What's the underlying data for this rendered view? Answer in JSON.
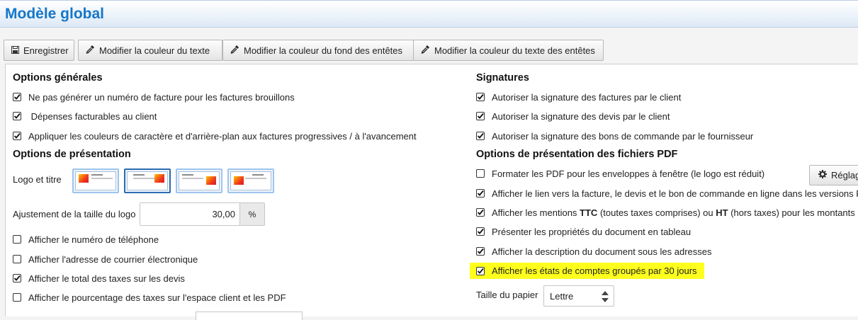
{
  "page": {
    "title": "Modèle global"
  },
  "toolbar": {
    "save_label": "Enregistrer",
    "text_color_label": "Modifier la couleur du texte",
    "header_bg_label": "Modifier la couleur du fond des entêtes",
    "header_text_label": "Modifier la couleur du texte des entêtes"
  },
  "general": {
    "title": "Options générales",
    "options": [
      {
        "label": "Ne pas générer un numéro de facture pour les factures brouillons",
        "checked": true
      },
      {
        "label": " Dépenses facturables au client",
        "checked": true
      },
      {
        "label": "Appliquer les couleurs de caractère et d'arrière-plan aux factures progressives / à l'avancement",
        "checked": true
      }
    ]
  },
  "presentation": {
    "title": "Options de présentation",
    "logo_label": "Logo et titre",
    "logo_size_label": "Ajustement de la taille du logo",
    "logo_size_value": "30,00",
    "logo_size_unit": "%",
    "options": [
      {
        "label": "Afficher le numéro de téléphone",
        "checked": false
      },
      {
        "label": "Afficher l'adresse de courrier électronique",
        "checked": false
      },
      {
        "label": "Afficher le total des taxes sur les devis",
        "checked": true
      },
      {
        "label": "Afficher le pourcentage des taxes sur l'espace client et les PDF",
        "checked": false
      }
    ]
  },
  "signatures": {
    "title": "Signatures",
    "options": [
      {
        "label": "Autoriser la signature des factures par le client",
        "checked": true
      },
      {
        "label": "Autoriser la signature des devis par le client",
        "checked": true
      },
      {
        "label": "Autoriser la signature des bons de commande par le fournisseur",
        "checked": true
      }
    ]
  },
  "pdf": {
    "title": "Options de présentation des fichiers PDF",
    "settings_button": "Réglag",
    "options": [
      {
        "label": "Formater les PDF pour les enveloppes à fenêtre (le logo est réduit)",
        "checked": false
      },
      {
        "label": "Afficher le lien vers la facture, le devis et le bon de commande en ligne dans les versions PDF",
        "checked": true
      },
      {
        "label_before": "Afficher les mentions ",
        "ttc": "TTC",
        "label_middle": " (toutes taxes comprises) ou ",
        "ht": "HT",
        "label_after": " (hors taxes) pour les montants",
        "checked": true
      },
      {
        "label": "Présenter les propriétés du document en tableau",
        "checked": true
      },
      {
        "label": "Afficher la description du document sous les adresses",
        "checked": true
      },
      {
        "label": "Afficher les états de comptes groupés par 30 jours",
        "checked": true,
        "highlighted": true
      }
    ],
    "paper_label": "Taille du papier",
    "paper_value": "Lettre"
  },
  "colors": {
    "title": "#1577c8",
    "highlight": "#ffff1e"
  }
}
